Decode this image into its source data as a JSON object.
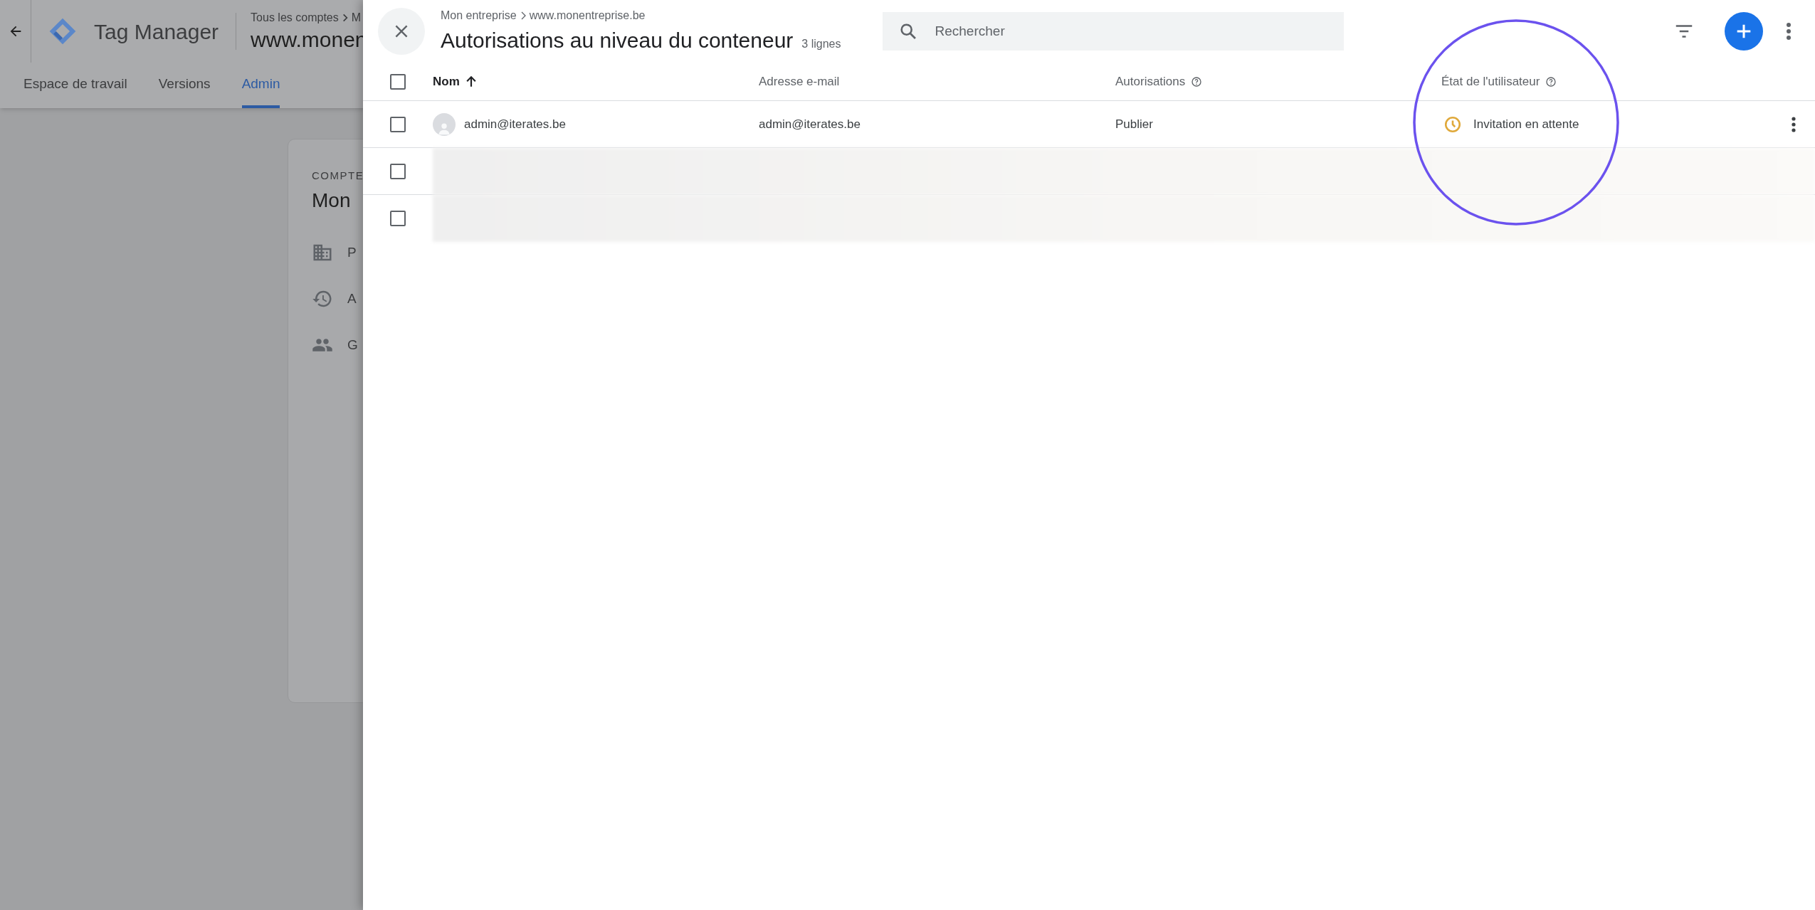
{
  "app": {
    "title": "Tag Manager",
    "breadcrumb": [
      "Tous les comptes",
      "M"
    ],
    "container_name": "www.monen"
  },
  "tabs": [
    {
      "label": "Espace de travail",
      "selected": false
    },
    {
      "label": "Versions",
      "selected": false
    },
    {
      "label": "Admin",
      "selected": true
    }
  ],
  "account_card": {
    "label": "COMPTE",
    "name": "Mon",
    "items": [
      {
        "kind": "building",
        "label": "P"
      },
      {
        "kind": "history",
        "label": "A"
      },
      {
        "kind": "people",
        "label": "G"
      }
    ]
  },
  "panel": {
    "breadcrumb": [
      "Mon entreprise",
      "www.monentreprise.be"
    ],
    "title": "Autorisations au niveau du conteneur",
    "row_count": "3 lignes",
    "search": {
      "placeholder": "Rechercher"
    },
    "all_checked": false,
    "columns": [
      {
        "label": "Nom",
        "sorted": true,
        "help": false
      },
      {
        "label": "Adresse e-mail",
        "sorted": false,
        "help": false
      },
      {
        "label": "Autorisations",
        "sorted": false,
        "help": true
      },
      {
        "label": "État de l'utilisateur",
        "sorted": false,
        "help": true
      }
    ],
    "rows": [
      {
        "kind": "user",
        "checked": false,
        "name": "admin@iterates.be",
        "email": "admin@iterates.be",
        "permission": "Publier",
        "status": "Invitation en attente"
      },
      {
        "kind": "blurred",
        "checked": false
      },
      {
        "kind": "blurred",
        "checked": false
      }
    ]
  }
}
